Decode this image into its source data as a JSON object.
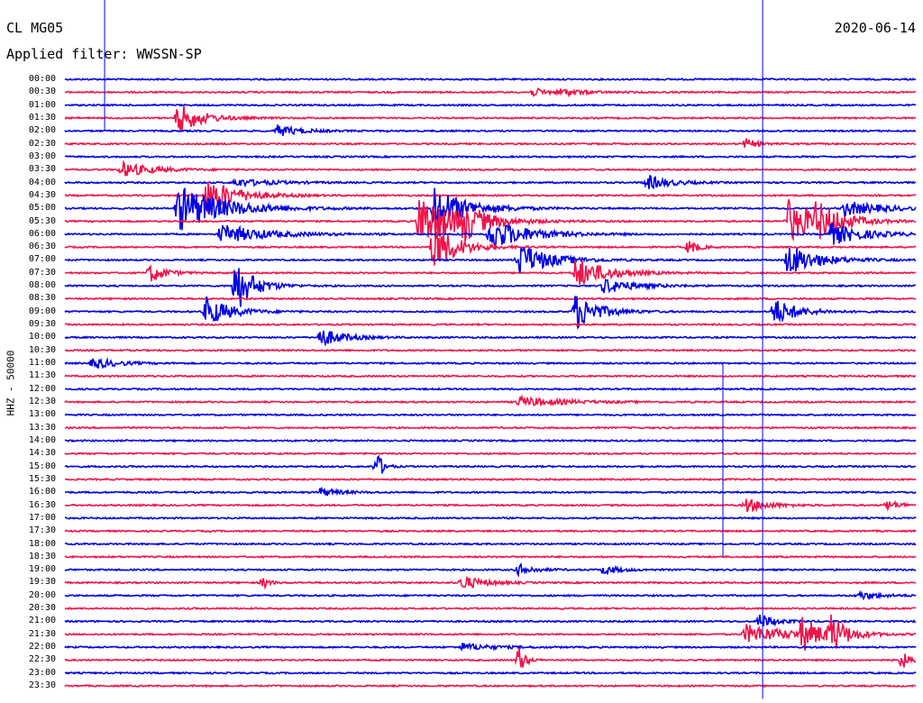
{
  "header": {
    "station": "CL MG05",
    "date": "2020-06-14",
    "filter": "Applied filter: WWSSN-SP"
  },
  "colors": {
    "series_a": "#0000e6",
    "series_b": "#f0144b",
    "background": "#ffffff",
    "text": "#000000"
  },
  "chart_data": {
    "type": "line",
    "title": "",
    "ylabel": "HHZ - 50000",
    "xlabel": "",
    "trace_colors_alternate": [
      "#0000e6",
      "#f0144b"
    ],
    "rows": [
      "00:00",
      "00:30",
      "01:00",
      "01:30",
      "02:00",
      "02:30",
      "03:00",
      "03:30",
      "04:00",
      "04:30",
      "05:00",
      "05:30",
      "06:00",
      "06:30",
      "07:00",
      "07:30",
      "08:00",
      "08:30",
      "09:00",
      "09:30",
      "10:00",
      "10:30",
      "11:00",
      "11:30",
      "12:00",
      "12:30",
      "13:00",
      "13:30",
      "14:00",
      "14:30",
      "15:00",
      "15:30",
      "16:00",
      "16:30",
      "17:00",
      "17:30",
      "18:00",
      "18:30",
      "19:00",
      "19:30",
      "20:00",
      "20:30",
      "21:00",
      "21:30",
      "22:00",
      "22:30",
      "23:00",
      "23:30"
    ],
    "row_minutes": 30,
    "baseline_noise": 0.12,
    "events": [
      {
        "row": 1,
        "minute": 16.5,
        "amp": 0.6,
        "dur": 1.2
      },
      {
        "row": 1,
        "minute": 17.5,
        "amp": 0.5,
        "dur": 1.5
      },
      {
        "row": 3,
        "minute": 4,
        "amp": 2.5,
        "dur": 1.5
      },
      {
        "row": 4,
        "minute": 7.5,
        "amp": 0.9,
        "dur": 1.5
      },
      {
        "row": 5,
        "minute": 24,
        "amp": 0.8,
        "dur": 0.8
      },
      {
        "row": 7,
        "minute": 2,
        "amp": 1.2,
        "dur": 2
      },
      {
        "row": 8,
        "minute": 6,
        "amp": 0.6,
        "dur": 2.5
      },
      {
        "row": 8,
        "minute": 20.5,
        "amp": 1.2,
        "dur": 1.5
      },
      {
        "row": 9,
        "minute": 5,
        "amp": 2.8,
        "dur": 2
      },
      {
        "row": 10,
        "minute": 4,
        "amp": 3.8,
        "dur": 3
      },
      {
        "row": 10,
        "minute": 13,
        "amp": 3.5,
        "dur": 2.2
      },
      {
        "row": 10,
        "minute": 27.5,
        "amp": 1.2,
        "dur": 2.5
      },
      {
        "row": 11,
        "minute": 12.5,
        "amp": 4.5,
        "dur": 2.5
      },
      {
        "row": 11,
        "minute": 14,
        "amp": 2.5,
        "dur": 1.2
      },
      {
        "row": 11,
        "minute": 25.5,
        "amp": 3.5,
        "dur": 2
      },
      {
        "row": 11,
        "minute": 26.5,
        "amp": 2.2,
        "dur": 1.5
      },
      {
        "row": 12,
        "minute": 5.5,
        "amp": 1.5,
        "dur": 3
      },
      {
        "row": 12,
        "minute": 15,
        "amp": 2.5,
        "dur": 2.5
      },
      {
        "row": 12,
        "minute": 27,
        "amp": 1.8,
        "dur": 2.2
      },
      {
        "row": 13,
        "minute": 13,
        "amp": 4,
        "dur": 1.5
      },
      {
        "row": 13,
        "minute": 22,
        "amp": 1.2,
        "dur": 0.6
      },
      {
        "row": 14,
        "minute": 16,
        "amp": 2.8,
        "dur": 2
      },
      {
        "row": 14,
        "minute": 25.5,
        "amp": 2.5,
        "dur": 2
      },
      {
        "row": 15,
        "minute": 3,
        "amp": 1.5,
        "dur": 1
      },
      {
        "row": 15,
        "minute": 18,
        "amp": 2.5,
        "dur": 2
      },
      {
        "row": 16,
        "minute": 6,
        "amp": 4.5,
        "dur": 1.2
      },
      {
        "row": 16,
        "minute": 19,
        "amp": 1.2,
        "dur": 2
      },
      {
        "row": 18,
        "minute": 5,
        "amp": 2.5,
        "dur": 1.5
      },
      {
        "row": 18,
        "minute": 18,
        "amp": 3,
        "dur": 1.5
      },
      {
        "row": 18,
        "minute": 25,
        "amp": 2.2,
        "dur": 1.5
      },
      {
        "row": 20,
        "minute": 9,
        "amp": 1.5,
        "dur": 1.5
      },
      {
        "row": 22,
        "minute": 1,
        "amp": 0.9,
        "dur": 1.5
      },
      {
        "row": 25,
        "minute": 16,
        "amp": 0.8,
        "dur": 3
      },
      {
        "row": 30,
        "minute": 11,
        "amp": 2.5,
        "dur": 0.4
      },
      {
        "row": 32,
        "minute": 9,
        "amp": 0.7,
        "dur": 1.2
      },
      {
        "row": 33,
        "minute": 24,
        "amp": 1.1,
        "dur": 1.5
      },
      {
        "row": 33,
        "minute": 29,
        "amp": 0.7,
        "dur": 1
      },
      {
        "row": 38,
        "minute": 16,
        "amp": 0.9,
        "dur": 1
      },
      {
        "row": 38,
        "minute": 19,
        "amp": 0.8,
        "dur": 1
      },
      {
        "row": 39,
        "minute": 7,
        "amp": 1,
        "dur": 0.4
      },
      {
        "row": 39,
        "minute": 14,
        "amp": 1.1,
        "dur": 1.5
      },
      {
        "row": 40,
        "minute": 28,
        "amp": 0.6,
        "dur": 1.5
      },
      {
        "row": 42,
        "minute": 24.5,
        "amp": 1.2,
        "dur": 1
      },
      {
        "row": 43,
        "minute": 24,
        "amp": 1.5,
        "dur": 3
      },
      {
        "row": 43,
        "minute": 26,
        "amp": 2.5,
        "dur": 1.2
      },
      {
        "row": 43,
        "minute": 27,
        "amp": 2.8,
        "dur": 1
      },
      {
        "row": 44,
        "minute": 14,
        "amp": 0.6,
        "dur": 2
      },
      {
        "row": 45,
        "minute": 16,
        "amp": 2.5,
        "dur": 0.4
      },
      {
        "row": 45,
        "minute": 29.5,
        "amp": 1.4,
        "dur": 0.6
      }
    ],
    "spikes": [
      {
        "minute": 24.6,
        "from_row": 0,
        "to_row": 48
      },
      {
        "minute": 23.2,
        "from_row": 22,
        "to_row": 37
      },
      {
        "minute": 1.4,
        "from_row": 0,
        "to_row": 4
      }
    ]
  }
}
